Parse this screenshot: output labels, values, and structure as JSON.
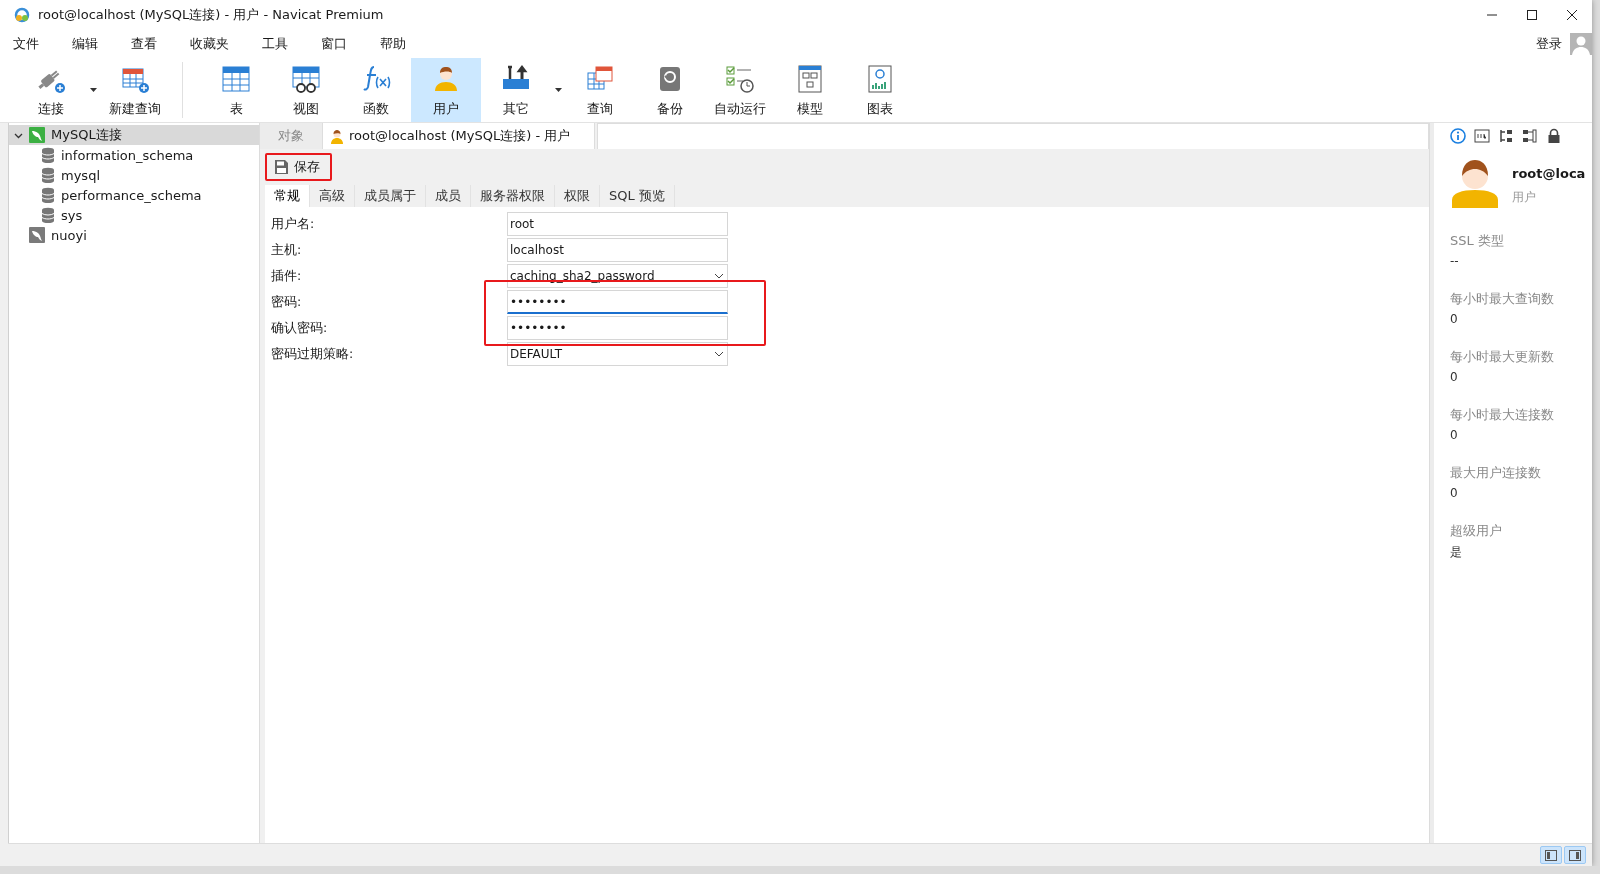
{
  "window": {
    "title": "root@localhost (MySQL连接) - 用户 - Navicat Premium"
  },
  "menu": [
    "文件",
    "编辑",
    "查看",
    "收藏夹",
    "工具",
    "窗口",
    "帮助"
  ],
  "account": {
    "label": "登录"
  },
  "toolbar": [
    {
      "label": "连接",
      "selected": false,
      "dropdown": true
    },
    {
      "label": "新建查询",
      "selected": false,
      "dropdown": false
    },
    {
      "label": "表",
      "selected": false,
      "dropdown": false
    },
    {
      "label": "视图",
      "selected": false,
      "dropdown": false
    },
    {
      "label": "函数",
      "selected": false,
      "dropdown": false
    },
    {
      "label": "用户",
      "selected": true,
      "dropdown": false
    },
    {
      "label": "其它",
      "selected": false,
      "dropdown": true
    },
    {
      "label": "查询",
      "selected": false,
      "dropdown": false
    },
    {
      "label": "备份",
      "selected": false,
      "dropdown": false
    },
    {
      "label": "自动运行",
      "selected": false,
      "dropdown": false
    },
    {
      "label": "模型",
      "selected": false,
      "dropdown": false
    },
    {
      "label": "图表",
      "selected": false,
      "dropdown": false
    }
  ],
  "tree": [
    {
      "label": "MySQL连接",
      "kind": "connection",
      "open": true,
      "expanded": true,
      "selected": true,
      "children": [
        {
          "label": "information_schema",
          "kind": "database",
          "selected": false
        },
        {
          "label": "mysql",
          "kind": "database",
          "selected": false
        },
        {
          "label": "performance_schema",
          "kind": "database",
          "selected": false
        },
        {
          "label": "sys",
          "kind": "database",
          "selected": false
        }
      ]
    },
    {
      "label": "nuoyi",
      "kind": "connection",
      "open": false,
      "selected": false
    }
  ],
  "tabs": [
    {
      "label": "对象",
      "selected": false,
      "kind": "plain"
    },
    {
      "label": "root@localhost (MySQL连接) - 用户",
      "selected": true,
      "kind": "user"
    }
  ],
  "save_button": {
    "label": "保存",
    "highlighted": true
  },
  "subtabs": [
    {
      "label": "常规",
      "selected": true
    },
    {
      "label": "高级",
      "selected": false
    },
    {
      "label": "成员属于",
      "selected": false
    },
    {
      "label": "成员",
      "selected": false
    },
    {
      "label": "服务器权限",
      "selected": false
    },
    {
      "label": "权限",
      "selected": false
    },
    {
      "label": "SQL 预览",
      "selected": false
    }
  ],
  "form": [
    {
      "label": "用户名:",
      "kind": "text",
      "value": "root",
      "focused": false,
      "highlighted": false
    },
    {
      "label": "主机:",
      "kind": "text",
      "value": "localhost",
      "focused": false,
      "highlighted": false
    },
    {
      "label": "插件:",
      "kind": "select",
      "value": "caching_sha2_password",
      "focused": false,
      "highlighted": false
    },
    {
      "label": "密码:",
      "kind": "password",
      "value": "••••••••",
      "focused": true,
      "highlighted": true
    },
    {
      "label": "确认密码:",
      "kind": "password",
      "value": "••••••••",
      "focused": false,
      "highlighted": true
    },
    {
      "label": "密码过期策略:",
      "kind": "select",
      "value": "DEFAULT",
      "focused": false,
      "highlighted": false
    }
  ],
  "info": {
    "name": "root@loca",
    "role": "用户",
    "fields": [
      {
        "label": "SSL 类型",
        "value": "--"
      },
      {
        "label": "每小时最大查询数",
        "value": "0"
      },
      {
        "label": "每小时最大更新数",
        "value": "0"
      },
      {
        "label": "每小时最大连接数",
        "value": "0"
      },
      {
        "label": "最大用户连接数",
        "value": "0"
      },
      {
        "label": "超级用户",
        "value": "是"
      }
    ]
  },
  "status_buttons": [
    {
      "selected": true
    },
    {
      "selected": true
    }
  ]
}
